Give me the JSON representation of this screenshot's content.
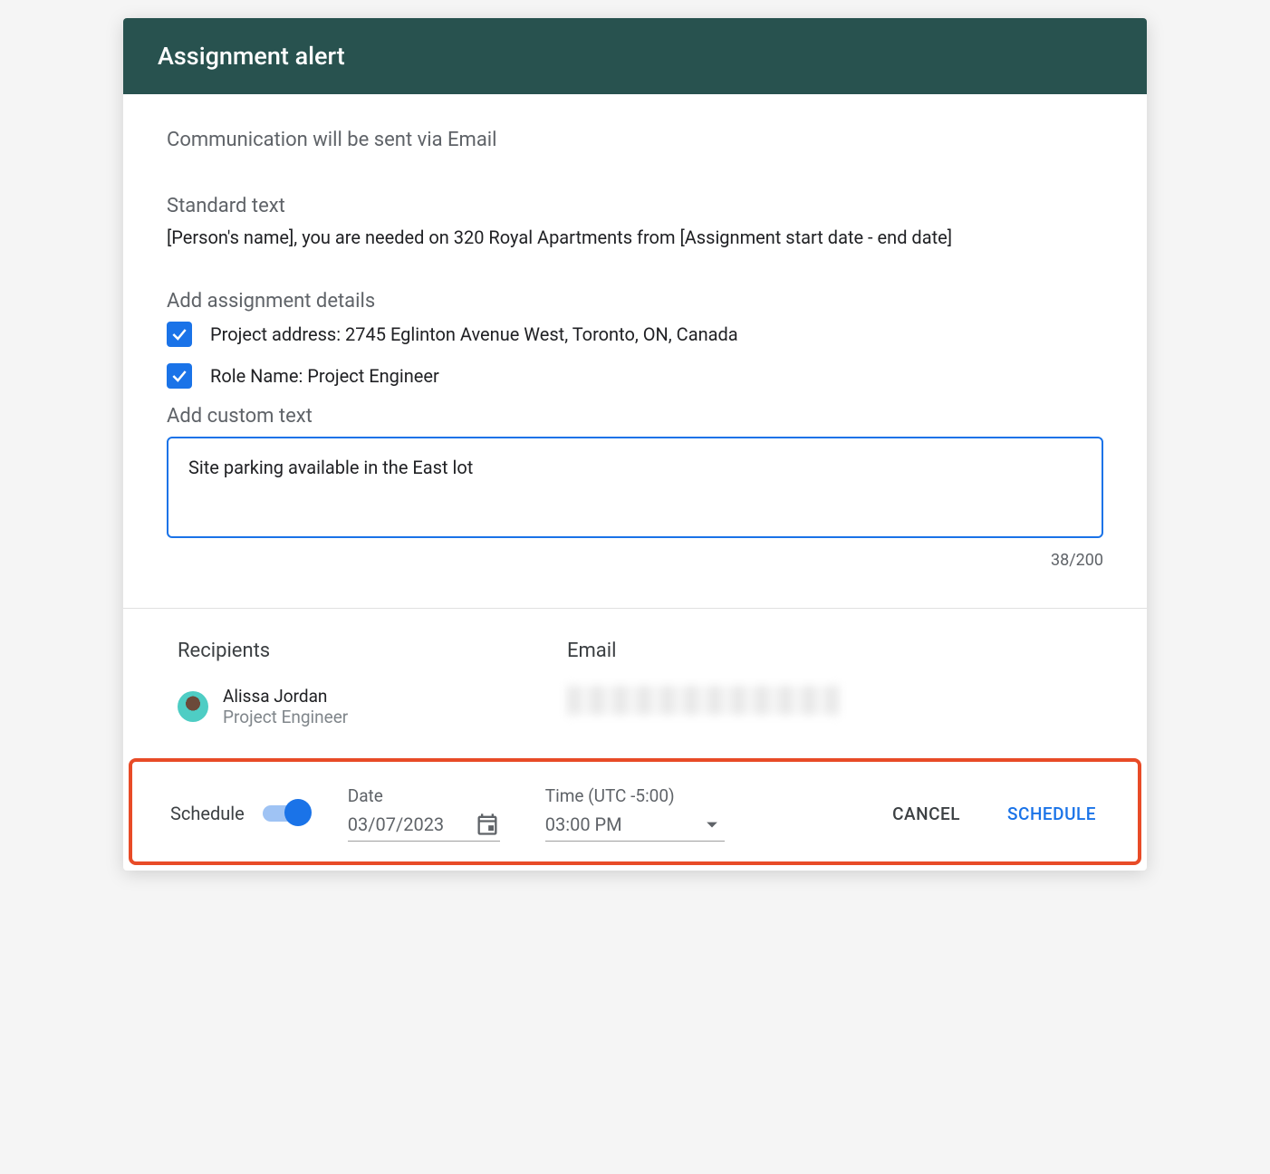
{
  "header": {
    "title": "Assignment alert"
  },
  "intro": "Communication will be sent via Email",
  "standard": {
    "label": "Standard text",
    "value": "[Person's name], you are needed on 320 Royal Apartments from [Assignment start date - end date]"
  },
  "details": {
    "label": "Add assignment details",
    "items": [
      {
        "checked": true,
        "text": "Project address: 2745 Eglinton Avenue West, Toronto, ON, Canada"
      },
      {
        "checked": true,
        "text": "Role Name: Project Engineer"
      }
    ]
  },
  "custom": {
    "label": "Add custom text",
    "value": "Site parking available in the East lot",
    "count": "38/200"
  },
  "recipients": {
    "header": "Recipients",
    "email_header": "Email",
    "list": [
      {
        "name": "Alissa Jordan",
        "role": "Project Engineer"
      }
    ]
  },
  "schedule": {
    "label": "Schedule",
    "enabled": true,
    "date_label": "Date",
    "date_value": "03/07/2023",
    "time_label": "Time (UTC -5:00)",
    "time_value": "03:00 PM",
    "cancel_label": "Cancel",
    "submit_label": "Schedule"
  }
}
